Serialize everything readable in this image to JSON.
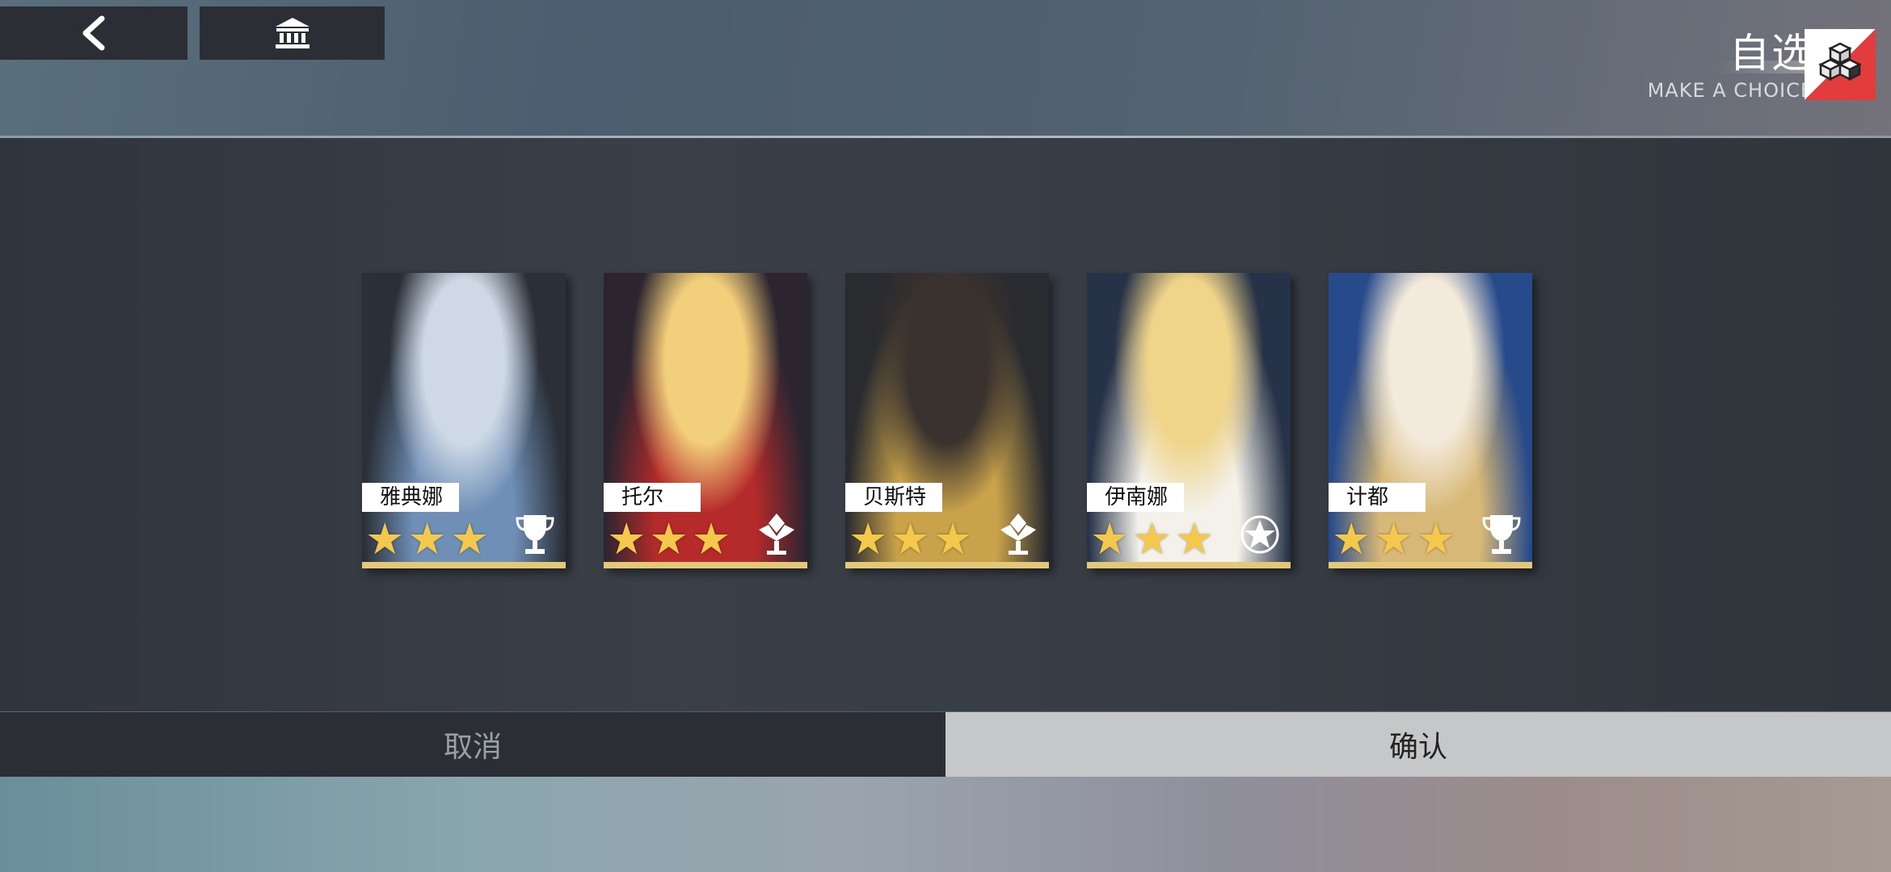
{
  "header": {
    "title_cn": "自选",
    "title_en": "MAKE A CHOICE",
    "back_icon": "chevron-left-icon",
    "museum_icon": "museum-icon",
    "choice_icon": "cubes-icon"
  },
  "cards": [
    {
      "name": "雅典娜",
      "stars": 3,
      "class_icon": "trophy-icon",
      "colors": [
        "#cfd9e6",
        "#6f8fb6",
        "#2a2f38"
      ]
    },
    {
      "name": "托尔",
      "stars": 3,
      "class_icon": "crest-icon",
      "colors": [
        "#f2cf7a",
        "#b52a2a",
        "#2c2530"
      ]
    },
    {
      "name": "贝斯特",
      "stars": 3,
      "class_icon": "crest-icon",
      "colors": [
        "#3a322e",
        "#c9a24a",
        "#2a2b2f"
      ]
    },
    {
      "name": "伊南娜",
      "stars": 3,
      "class_icon": "star-emblem-icon",
      "colors": [
        "#f0d48a",
        "#f3f1ea",
        "#263247"
      ]
    },
    {
      "name": "计都",
      "stars": 3,
      "class_icon": "trophy-icon",
      "colors": [
        "#f3eadb",
        "#d8b877",
        "#274a8a"
      ]
    }
  ],
  "footer": {
    "cancel_label": "取消",
    "confirm_label": "确认"
  }
}
